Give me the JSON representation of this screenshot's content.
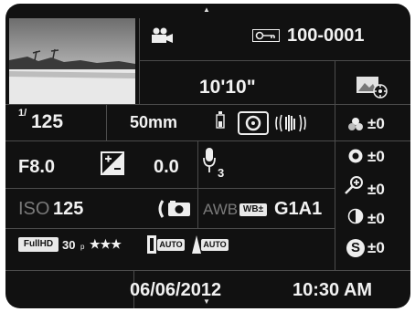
{
  "header": {
    "file_number": "100-0001",
    "protect_icon": "key-icon",
    "movie_icon": "movie-camera-icon"
  },
  "nav": {
    "up_arrow": "▲",
    "down_arrow": "▼"
  },
  "thumbnail": {
    "description_icon": "beach-photo-thumbnail"
  },
  "recording": {
    "duration": "10'10\""
  },
  "exposure": {
    "shutter_numerator": "1/",
    "shutter_denominator": "125",
    "focal_length": "50mm",
    "aperture": "F8.0",
    "ev_compensation": "0.0",
    "iso_label": "ISO",
    "iso_value": "125"
  },
  "audio": {
    "level": "3"
  },
  "white_balance": {
    "awb_label": "AWB",
    "wb_badge": "WB±",
    "shift": "G1A1"
  },
  "movie": {
    "fullhd_badge": "FullHD",
    "fps": "30",
    "fps_suffix": "p",
    "quality": "★★★"
  },
  "auto_badges": {
    "badge1": "AUTO",
    "badge2": "AUTO"
  },
  "picture_style": {
    "saturation": "±0",
    "hue": "±0",
    "key": "±0",
    "contrast": "±0",
    "sharpness": "±0",
    "sharpness_glyph": "S"
  },
  "footer": {
    "date": "06/06/2012",
    "time": "10:30 AM"
  }
}
